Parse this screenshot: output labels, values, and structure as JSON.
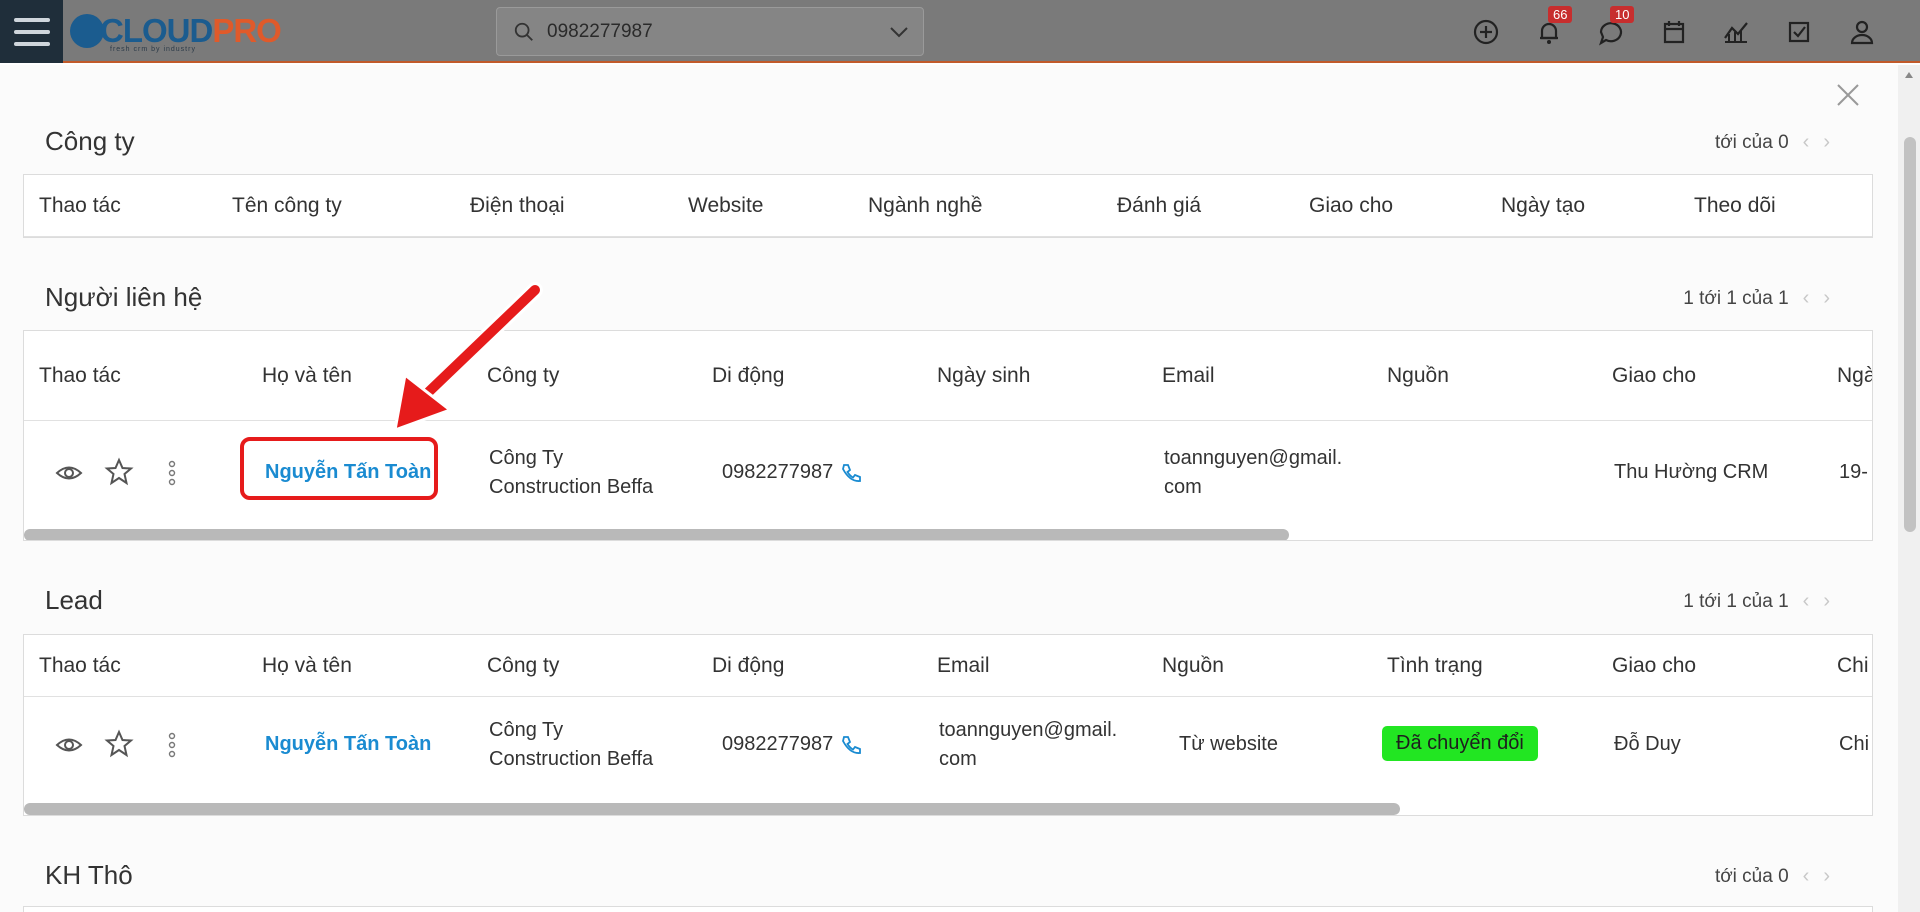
{
  "header": {
    "logo_text_1": "CLOUD",
    "logo_text_2": "PRO",
    "logo_tagline": "fresh crm by industry",
    "search_value": "0982277987",
    "notifications_badge": "66",
    "messages_badge": "10"
  },
  "sections": {
    "company": {
      "title": "Công ty",
      "pager": "tới của 0",
      "columns": [
        "Thao tác",
        "Tên công ty",
        "Điện thoại",
        "Website",
        "Ngành nghề",
        "Đánh giá",
        "Giao cho",
        "Ngày tạo",
        "Theo dõi"
      ]
    },
    "contacts": {
      "title": "Người liên hệ",
      "pager": "1 tới 1 của 1",
      "columns": [
        "Thao tác",
        "Họ và tên",
        "Công ty",
        "Di động",
        "Ngày sinh",
        "Email",
        "Nguồn",
        "Giao cho",
        "Ngà"
      ],
      "row": {
        "name": "Nguyễn Tấn Toàn",
        "company_line1": "Công Ty",
        "company_line2": "Construction Beffa",
        "mobile": "0982277987",
        "email_line1": "toannguyen@gmail.",
        "email_line2": "com",
        "assigned": "Thu Hường CRM",
        "date_partial": "19-"
      }
    },
    "lead": {
      "title": "Lead",
      "pager": "1 tới 1 của 1",
      "columns": [
        "Thao tác",
        "Họ và tên",
        "Công ty",
        "Di động",
        "Email",
        "Nguồn",
        "Tình trạng",
        "Giao cho",
        "Chi"
      ],
      "row": {
        "name": "Nguyễn Tấn Toàn",
        "company_line1": "Công Ty",
        "company_line2": "Construction Beffa",
        "mobile": "0982277987",
        "email_line1": "toannguyen@gmail.",
        "email_line2": "com",
        "source": "Từ website",
        "status": "Đã chuyển đổi",
        "assigned": "Đỗ Duy",
        "extra_partial": "Chi"
      }
    },
    "raw": {
      "title": "KH Thô",
      "pager": "tới của 0"
    }
  },
  "colors": {
    "link": "#1a8bd1",
    "status_green": "#22e622",
    "highlight_red": "#e61b1b"
  }
}
